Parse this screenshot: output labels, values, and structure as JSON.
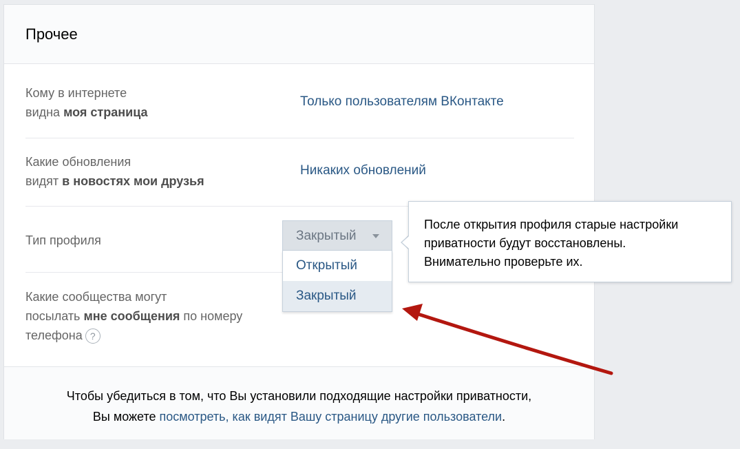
{
  "section": {
    "title": "Прочее",
    "rows": [
      {
        "label_plain": "Кому в интернете",
        "label_line2_plain": "видна ",
        "label_line2_bold": "моя страница",
        "value": "Только пользователям ВКонтакте"
      },
      {
        "label_plain": "Какие обновления",
        "label_line2_plain": "видят ",
        "label_line2_bold": "в новостях мои друзья",
        "value": "Никаких обновлений"
      },
      {
        "label": "Тип профиля"
      },
      {
        "line1": "Какие сообщества могут",
        "line2_plain": "посылать ",
        "line2_bold": "мне сообщения",
        "line2_rest": " по номеру",
        "line3": "телефона",
        "help_icon": "?"
      }
    ]
  },
  "profile_type_select": {
    "value": "Закрытый",
    "options": [
      "Открытый",
      "Закрытый"
    ],
    "highlighted_option": "Закрытый"
  },
  "tooltip": {
    "line1": "После открытия профиля старые настройки",
    "line2": "приватности будут восстановлены.",
    "line3": "Внимательно проверьте их."
  },
  "footer": {
    "text_line1": "Чтобы убедиться в том, что Вы установили подходящие настройки приватности,",
    "text_line2_prefix": "Вы можете ",
    "link": "посмотреть, как видят Вашу страницу другие пользователи",
    "text_line2_suffix": "."
  },
  "colors": {
    "link": "#2a5885",
    "label": "#656565",
    "page_bg": "#ebedf0",
    "annotation_arrow": "#b3170f"
  },
  "icons": {
    "help": "question-circle-icon",
    "dropdown": "caret-down-icon",
    "annotation": "red-arrow-annotation"
  }
}
